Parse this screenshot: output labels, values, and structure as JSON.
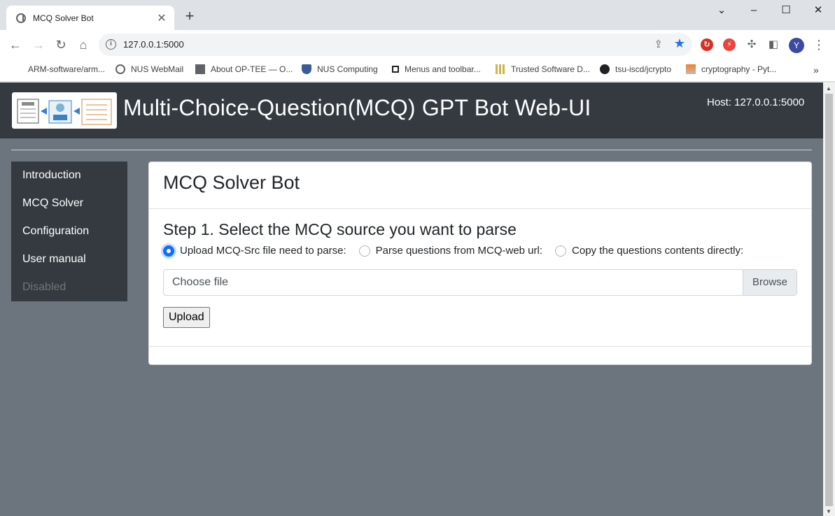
{
  "browser": {
    "tab_title": "MCQ Solver Bot",
    "url": "127.0.0.1:5000",
    "avatar_letter": "Y",
    "bookmarks": [
      {
        "label": "ARM-software/arm...",
        "icon": "github-icon"
      },
      {
        "label": "NUS WebMail",
        "icon": "globe-icon"
      },
      {
        "label": "About OP-TEE — O...",
        "icon": "building-icon"
      },
      {
        "label": "NUS Computing",
        "icon": "shield-icon"
      },
      {
        "label": "Menus and toolbar...",
        "icon": "square-icon"
      },
      {
        "label": "Trusted Software D...",
        "icon": "grid-icon"
      },
      {
        "label": "tsu-iscd/jcrypto",
        "icon": "github-icon"
      },
      {
        "label": "cryptography - Pyt...",
        "icon": "stack-icon"
      }
    ]
  },
  "page": {
    "title": "Multi-Choice-Question(MCQ) GPT Bot Web-UI",
    "host": "Host: 127.0.0.1:5000",
    "sidebar": [
      {
        "label": "Introduction",
        "disabled": false
      },
      {
        "label": "MCQ Solver",
        "disabled": false
      },
      {
        "label": "Configuration",
        "disabled": false
      },
      {
        "label": "User manual",
        "disabled": false
      },
      {
        "label": "Disabled",
        "disabled": true
      }
    ],
    "card": {
      "header": "MCQ Solver Bot",
      "step": "Step 1. Select the MCQ source you want to parse",
      "options": [
        {
          "label": "Upload MCQ-Src file need to parse:",
          "checked": true
        },
        {
          "label": "Parse questions from MCQ-web url:",
          "checked": false
        },
        {
          "label": "Copy the questions contents directly:",
          "checked": false
        }
      ],
      "file_placeholder": "Choose file",
      "browse_label": "Browse",
      "upload_label": "Upload"
    }
  },
  "colors": {
    "accent": "#0d6efd",
    "header_bg": "#343a40",
    "page_bg": "#6c757d"
  }
}
